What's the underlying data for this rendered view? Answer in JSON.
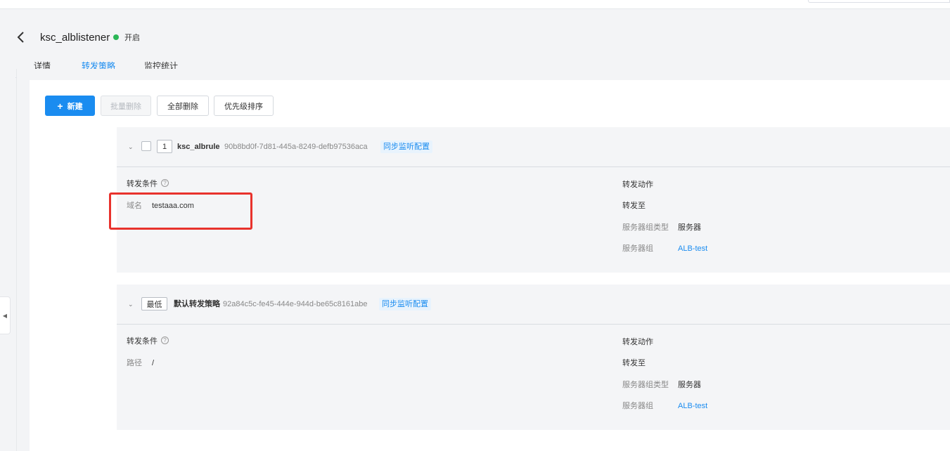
{
  "header": {
    "title": "ksc_alblistener",
    "status": "开启",
    "status_color": "#2bb656",
    "back_icon": "chevron-left-icon"
  },
  "tabs": [
    {
      "label": "详情",
      "active": false
    },
    {
      "label": "转发策略",
      "active": true
    },
    {
      "label": "监控统计",
      "active": false
    }
  ],
  "toolbar": {
    "new_label": "新建",
    "batch_delete_label": "批量删除",
    "delete_all_label": "全部删除",
    "priority_sort_label": "优先级排序"
  },
  "rules": [
    {
      "priority": "1",
      "name": "ksc_albrule",
      "id": "90b8bd0f-7d81-445a-8249-defb97536aca",
      "sync_label": "同步监听配置",
      "condition_title": "转发条件",
      "condition_key": "域名",
      "condition_value": "testaaa.com",
      "action_title": "转发动作",
      "forward_to": "转发至",
      "server_group_type_key": "服务器组类型",
      "server_group_type_value": "服务器",
      "server_group_key": "服务器组",
      "server_group_value": "ALB-test"
    },
    {
      "priority": "最低",
      "name": "默认转发策略",
      "id": "92a84c5c-fe45-444e-944d-be65c8161abe",
      "sync_label": "同步监听配置",
      "condition_title": "转发条件",
      "condition_key": "路径",
      "condition_value": "/",
      "action_title": "转发动作",
      "forward_to": "转发至",
      "server_group_type_key": "服务器组类型",
      "server_group_type_value": "服务器",
      "server_group_key": "服务器组",
      "server_group_value": "ALB-test"
    }
  ],
  "colors": {
    "accent": "#1a8cf0",
    "highlight": "#e8322c"
  }
}
